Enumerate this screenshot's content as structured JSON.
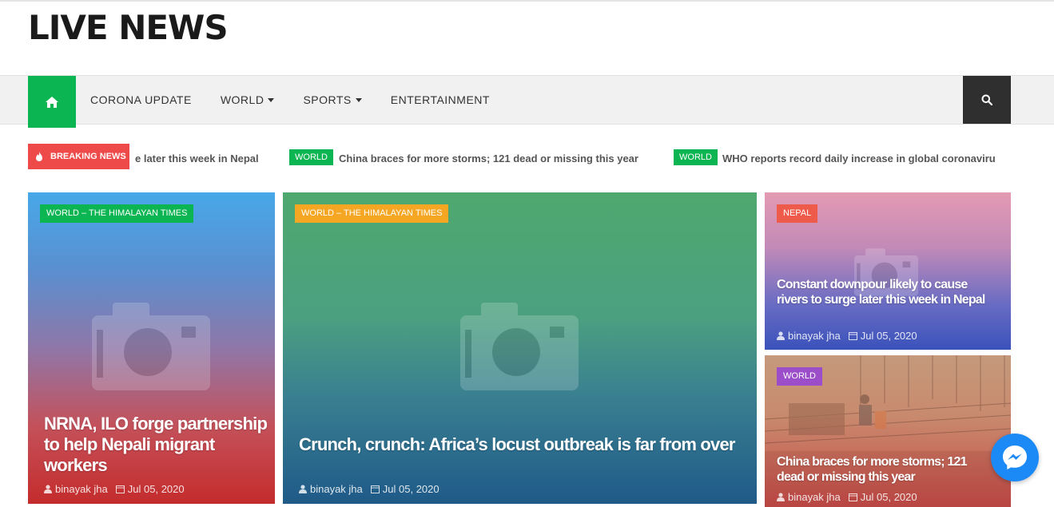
{
  "site": {
    "logo": "LIVE NEWS"
  },
  "nav": {
    "items": [
      {
        "label": "CORONA UPDATE",
        "dropdown": false
      },
      {
        "label": "WORLD",
        "dropdown": true
      },
      {
        "label": "SPORTS",
        "dropdown": true
      },
      {
        "label": "ENTERTAINMENT",
        "dropdown": false
      }
    ],
    "home_icon": "home-icon",
    "search_icon": "search-icon",
    "accent_color": "#0bb552"
  },
  "ticker": {
    "label": "BREAKING NEWS",
    "items": [
      {
        "badge": "",
        "text": "e later this week in Nepal"
      },
      {
        "badge": "WORLD",
        "text": "China braces for more storms; 121 dead or missing this year"
      },
      {
        "badge": "WORLD",
        "text": "WHO reports record daily increase in global coronaviru"
      }
    ]
  },
  "cards": [
    {
      "badge": "WORLD – THE HIMALAYAN TIMES",
      "badge_color": "#0bb552",
      "title": "NRNA, ILO forge partnership to help Nepali migrant workers",
      "author": "binayak jha",
      "date": "Jul 05, 2020"
    },
    {
      "badge": "WORLD – THE HIMALAYAN TIMES",
      "badge_color": "#f5a623",
      "title": "Crunch, crunch: Africa’s locust outbreak is far from over",
      "author": "binayak jha",
      "date": "Jul 05, 2020"
    },
    {
      "badge": "NEPAL",
      "badge_color": "#ef5b4b",
      "title": "Constant downpour likely to cause rivers to surge later this week in Nepal",
      "author": "binayak jha",
      "date": "Jul 05, 2020"
    },
    {
      "badge": "WORLD",
      "badge_color": "#9b4dca",
      "title": "China braces for more storms; 121 dead or missing this year",
      "author": "binayak jha",
      "date": "Jul 05, 2020"
    }
  ],
  "chat_widget": {
    "icon": "messenger-icon"
  }
}
